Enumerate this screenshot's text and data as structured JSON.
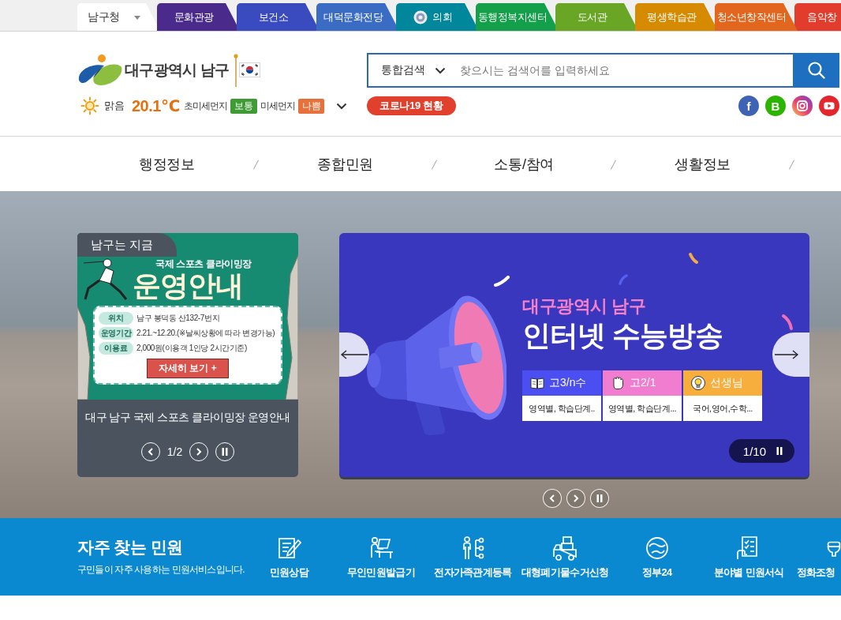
{
  "top_tabs": [
    {
      "label": "남구청",
      "kind": "dropdown",
      "selected": true
    },
    {
      "label": "문화관광",
      "kind": "link",
      "selected": false,
      "color": "#4a2b8c"
    },
    {
      "label": "보건소",
      "kind": "link",
      "selected": false,
      "color": "#3a4abf"
    },
    {
      "label": "대덕문화전당",
      "kind": "link",
      "selected": false,
      "color": "#3b6cc4"
    },
    {
      "label": "의회",
      "kind": "emblem",
      "selected": false,
      "color": "#00879c"
    },
    {
      "label": "동행정복지센터",
      "kind": "link",
      "selected": false,
      "color": "#14a04b"
    },
    {
      "label": "도서관",
      "kind": "link",
      "selected": false,
      "color": "#6aa626"
    },
    {
      "label": "평생학습관",
      "kind": "link",
      "selected": false,
      "color": "#d58a00"
    },
    {
      "label": "청소년창작센터",
      "kind": "link",
      "selected": false,
      "color": "#e2661e"
    },
    {
      "label": "음악창",
      "kind": "link",
      "selected": false,
      "color": "#e23d2c"
    }
  ],
  "header": {
    "logo": "대구광역시 남구",
    "search": {
      "scope": "통합검색",
      "placeholder": "찾으시는 검색어를 입력하세요"
    },
    "weather": {
      "condition": "맑음",
      "temperature": "20.1℃",
      "air_quality": [
        {
          "label": "초미세먼지",
          "status": "보통",
          "color": "#3f9b33"
        },
        {
          "label": "미세먼지",
          "status": "나쁨",
          "color": "#e8713b"
        }
      ]
    },
    "covid_button": "코로나19 현황",
    "social": [
      {
        "kind": "facebook",
        "glyph": "f"
      },
      {
        "kind": "blog",
        "glyph": "B"
      },
      {
        "kind": "instagram"
      },
      {
        "kind": "youtube"
      }
    ]
  },
  "main_menu": [
    {
      "label": "행정정보"
    },
    {
      "label": "종합민원"
    },
    {
      "label": "소통/참여"
    },
    {
      "label": "생활정보"
    }
  ],
  "hero": {
    "news_card": {
      "tag": "남구는 지금",
      "poster": {
        "subtitle": "국제 스포츠 클라이밍장",
        "title": "운영안내",
        "details": [
          {
            "label": "위치",
            "value": "남구 봉덕동 산132-7번지"
          },
          {
            "label": "운영기간",
            "value": "2.21.~12.20.(※날씨상황에 따라 변경가능)"
          },
          {
            "label": "이용료",
            "value": "2,000원(이용객 1인당 2시간기준)"
          }
        ],
        "button": "자세히 보기 +"
      },
      "caption": "대구 남구 국제 스포츠 클라이밍장 운영안내",
      "pager": "1/2"
    },
    "banner": {
      "kicker": "대구광역시 남구",
      "title": "인터넷 수능방송",
      "audiences": [
        {
          "kind": "book",
          "label": "고3/n수",
          "description": "영역별, 학습단계..",
          "color": "#4b4ef0"
        },
        {
          "kind": "hand",
          "label": "고2/1",
          "description": "영역별, 학습단계...",
          "color": "#f17dd0"
        },
        {
          "kind": "bulb",
          "label": "선생님",
          "description": "국어,영어,수학...",
          "color": "#f7ae3c"
        }
      ],
      "pager": "1/10"
    }
  },
  "frequent_services": {
    "title": "자주 찾는 민원",
    "subtitle": "구민들이 자주 사용하는 민원서비스입니다.",
    "items": [
      {
        "kind": "consult",
        "label": "민원상담"
      },
      {
        "kind": "kiosk",
        "label": "무인민원발급기"
      },
      {
        "kind": "family",
        "label": "전자가족관계등록"
      },
      {
        "kind": "waste",
        "label": "대형폐기물수거신청"
      },
      {
        "kind": "gov24",
        "label": "정부24"
      },
      {
        "kind": "forms",
        "label": "분야별 민원서식"
      },
      {
        "kind": "septic",
        "label": "정화조청"
      }
    ]
  }
}
